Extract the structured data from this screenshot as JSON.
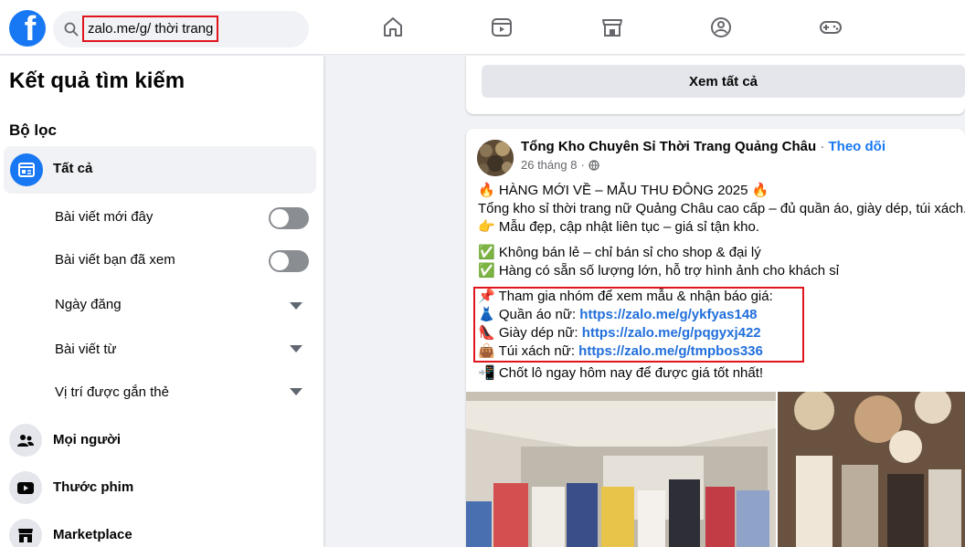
{
  "header": {
    "search_query": "zalo.me/g/ thời trang",
    "nav": [
      "home-icon",
      "video-icon",
      "marketplace-icon",
      "groups-icon",
      "gaming-icon"
    ]
  },
  "sidebar": {
    "title": "Kết quả tìm kiếm",
    "filters_heading": "Bộ lọc",
    "all_label": "Tất cả",
    "filters": [
      {
        "label": "Bài viết mới đây",
        "control": "toggle",
        "state": "off"
      },
      {
        "label": "Bài viết bạn đã xem",
        "control": "toggle",
        "state": "off"
      },
      {
        "label": "Ngày đăng",
        "control": "dropdown"
      },
      {
        "label": "Bài viết từ",
        "control": "dropdown"
      },
      {
        "label": "Vị trí được gắn thẻ",
        "control": "dropdown"
      }
    ],
    "categories": [
      {
        "label": "Mọi người",
        "icon": "people-icon"
      },
      {
        "label": "Thước phim",
        "icon": "reels-icon"
      },
      {
        "label": "Marketplace",
        "icon": "marketplace-icon"
      }
    ]
  },
  "main": {
    "see_all_label": "Xem tất cả",
    "post": {
      "author": "Tổng Kho Chuyên Sỉ Thời Trang Quảng Châu",
      "separator": "·",
      "follow_label": "Theo dõi",
      "date": "26 tháng 8",
      "line1": "🔥 HÀNG MỚI VỀ – MẪU THU ĐÔNG 2025 🔥",
      "line2": "Tổng kho sỉ thời trang nữ Quảng Châu cao cấp – đủ quần áo, giày dép, túi xách.",
      "line3": "👉 Mẫu đẹp, cập nhật liên tục – giá sỉ tận kho.",
      "line4": "✅ Không bán lẻ – chỉ bán sỉ cho shop & đại lý",
      "line5": "✅ Hàng có sẵn số lượng lớn, hỗ trợ hình ảnh cho khách sỉ",
      "line6": "📌 Tham gia nhóm để xem mẫu & nhận báo giá:",
      "link1_label": "👗 Quần áo nữ: ",
      "link1_url": "https://zalo.me/g/ykfyas148",
      "link2_label": "👠 Giày dép nữ: ",
      "link2_url": "https://zalo.me/g/pqgyxj422",
      "link3_label": "👜 Túi xách nữ: ",
      "link3_url": "https://zalo.me/g/tmpbos336",
      "line7": "📲 Chốt lô ngay hôm nay để được giá tốt nhất!"
    }
  },
  "colors": {
    "brand": "#1877f2",
    "link": "#216fdb",
    "highlight": "#e0141e",
    "page_bg": "#f0f2f5"
  }
}
